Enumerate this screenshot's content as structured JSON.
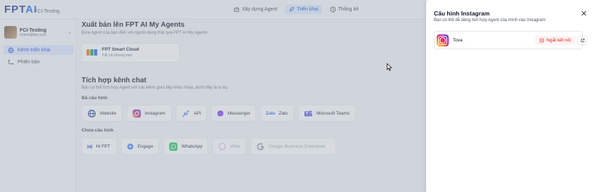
{
  "topbar": {
    "logo": "FPT",
    "logo_accent": "AI",
    "org_name": "FCI-Testing",
    "nav": [
      {
        "label": "Xây dựng Agent",
        "icon": "robot-icon",
        "active": false
      },
      {
        "label": "Triển khai",
        "icon": "rocket-icon",
        "active": true
      },
      {
        "label": "Thống kê",
        "icon": "clock-icon",
        "active": false
      }
    ]
  },
  "sidebar": {
    "account_name": "FCI-Testing",
    "account_email": "fcitest@fpt.com",
    "items": [
      {
        "label": "Kênh triển khai",
        "icon": "globe-icon",
        "active": true
      },
      {
        "label": "Phiên bản",
        "icon": "version-icon",
        "active": false
      }
    ]
  },
  "main": {
    "publish_title": "Xuất bản lên FPT AI My Agents",
    "publish_sub": "Đưa Agent của bạn đến với người dùng thật qua FPT AI My Agents",
    "publish_card_title": "FPT Smart Cloud",
    "publish_card_sub": "Tất cả phòng ban",
    "integrate_title": "Tích hợp kênh chat",
    "integrate_sub": "Bạn có thể tích hợp Agent với các kênh giao tiếp khác nhau, dưới đây là ví dụ.",
    "configured_label": "Đã cấu hình",
    "configured": [
      {
        "label": "Website",
        "icon": "globe-icon"
      },
      {
        "label": "Instagram",
        "icon": "instagram-icon"
      },
      {
        "label": "API",
        "icon": "api-icon"
      },
      {
        "label": "Messenger",
        "icon": "messenger-icon"
      },
      {
        "label": "Zalo",
        "icon": "zalo-icon"
      },
      {
        "label": "Microsoft Teams",
        "icon": "teams-icon"
      }
    ],
    "unconfigured_label": "Chưa cấu hình",
    "unconfigured": [
      {
        "label": "Hi FPT",
        "icon": "hi-fpt-icon",
        "disabled": false
      },
      {
        "label": "Engage",
        "icon": "engage-icon",
        "disabled": false
      },
      {
        "label": "WhatsApp",
        "icon": "whatsapp-icon",
        "disabled": false
      },
      {
        "label": "Viber",
        "icon": "viber-icon",
        "disabled": true
      },
      {
        "label": "Google Business Enterprise",
        "icon": "google-icon",
        "disabled": true
      }
    ]
  },
  "panel": {
    "title": "Cấu hình Instagram",
    "subtitle": "Bạn có thể dễ dàng tích hợp Agent của mình vào Instagram",
    "close_icon": "close-icon",
    "connection_name": "Tova",
    "disconnect_label": "Ngắt kết nối",
    "open_icon": "external-link-icon"
  },
  "colors": {
    "accent": "#2563eb",
    "danger": "#dc2626",
    "overlay": "#a0aab6"
  }
}
